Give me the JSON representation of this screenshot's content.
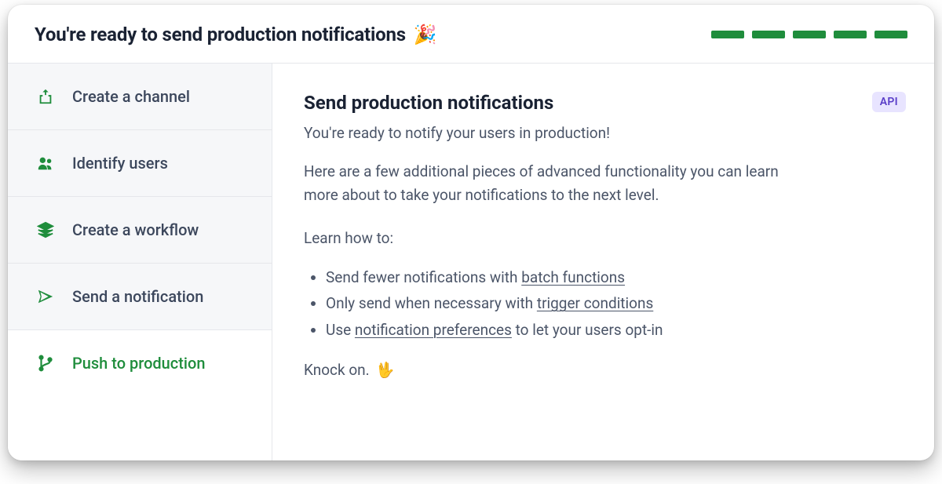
{
  "header": {
    "title": "You're ready to send production notifications",
    "title_emoji": "🎉",
    "progress_segments": 5
  },
  "sidebar": {
    "steps": [
      {
        "id": "create-channel",
        "label": "Create a channel",
        "icon": "upload-box",
        "active": false
      },
      {
        "id": "identify-users",
        "label": "Identify users",
        "icon": "users",
        "active": false
      },
      {
        "id": "create-workflow",
        "label": "Create a workflow",
        "icon": "layers",
        "active": false
      },
      {
        "id": "send-notification",
        "label": "Send a notification",
        "icon": "paper-plane",
        "active": false
      },
      {
        "id": "push-production",
        "label": "Push to production",
        "icon": "git-branch",
        "active": true
      }
    ]
  },
  "main": {
    "title": "Send production notifications",
    "badge": "API",
    "intro": "You're ready to notify your users in production!",
    "para": "Here are a few additional pieces of advanced functionality you can learn more about to take your notifications to the next level.",
    "learn_heading": "Learn how to:",
    "learn_items": [
      {
        "prefix": "Send fewer notifications with ",
        "link": "batch functions",
        "suffix": ""
      },
      {
        "prefix": "Only send when necessary with ",
        "link": "trigger conditions",
        "suffix": ""
      },
      {
        "prefix": "Use ",
        "link": "notification preferences",
        "suffix": " to let your users opt-in"
      }
    ],
    "signoff_text": "Knock on.",
    "signoff_emoji": "🖖"
  }
}
